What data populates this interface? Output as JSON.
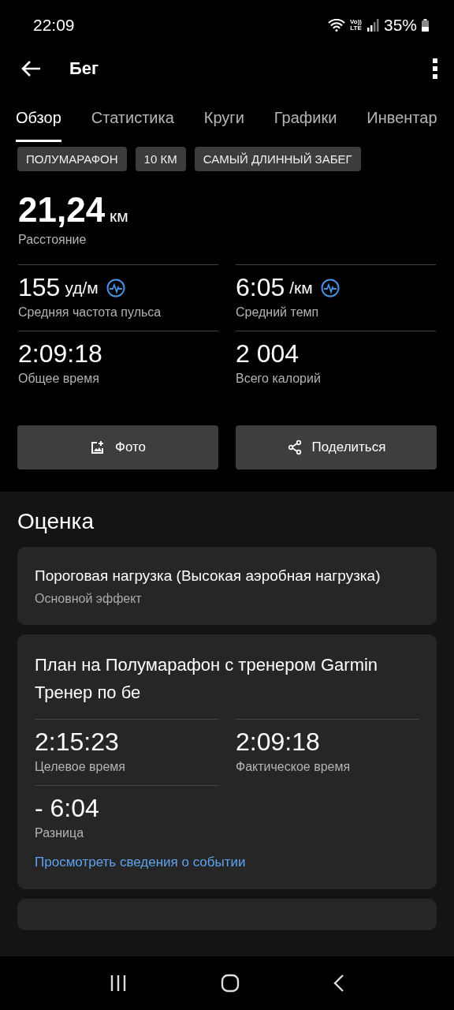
{
  "status_bar": {
    "time": "22:09",
    "network_label": [
      "Vo))",
      "LTE"
    ],
    "battery": "35%"
  },
  "header": {
    "title": "Бег"
  },
  "tabs": [
    {
      "label": "Обзор",
      "selected": true
    },
    {
      "label": "Статистика",
      "selected": false
    },
    {
      "label": "Круги",
      "selected": false
    },
    {
      "label": "Графики",
      "selected": false
    },
    {
      "label": "Инвентар",
      "selected": false
    }
  ],
  "tags": [
    "ПОЛУМАРАФОН",
    "10 КМ",
    "САМЫЙ ДЛИННЫЙ ЗАБЕГ"
  ],
  "distance": {
    "value": "21,24",
    "unit": "км",
    "label": "Расстояние"
  },
  "metrics": [
    {
      "value": "155",
      "unit": "уд/м",
      "label": "Средняя частота пульса",
      "kind": "chart"
    },
    {
      "value": "6:05",
      "unit": "/км",
      "label": "Средний темп",
      "kind": "chart"
    },
    {
      "value": "2:09:18",
      "label": "Общее время",
      "kind": "plain"
    },
    {
      "value": "2 004",
      "label": "Всего калорий",
      "kind": "plain"
    }
  ],
  "buttons": [
    {
      "label": "Фото",
      "kind": "photo"
    },
    {
      "label": "Поделиться",
      "kind": "share"
    }
  ],
  "assessment": {
    "title": "Оценка",
    "effect_card": {
      "title": "Пороговая нагрузка (Высокая аэробная нагрузка)",
      "subtitle": "Основной эффект"
    },
    "plan_card": {
      "title": "План на Полумарафон с тренером Garmin",
      "subtitle": "Тренер по бе",
      "stats": [
        {
          "value": "2:15:23",
          "label": "Целевое время"
        },
        {
          "value": "2:09:18",
          "label": "Фактическое время"
        },
        {
          "value": "- 6:04",
          "label": "Разница"
        }
      ],
      "link": "Просмотреть сведения о событии"
    }
  }
}
